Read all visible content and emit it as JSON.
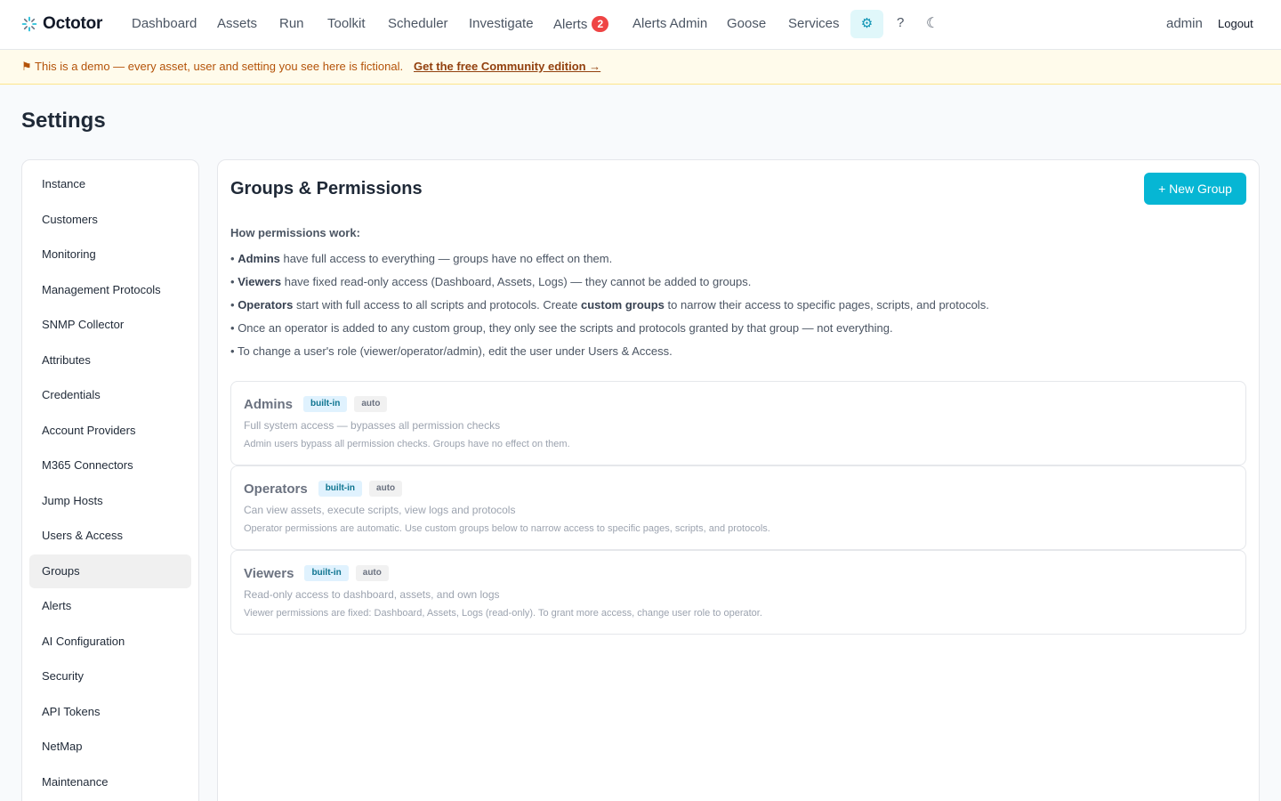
{
  "brand": {
    "name": "Octotor"
  },
  "nav": {
    "items": [
      "Dashboard",
      "Assets",
      "Run",
      "Toolkit",
      "Scheduler",
      "Investigate",
      "Alerts",
      "Alerts Admin",
      "Goose",
      "Services"
    ],
    "alerts_count": "2",
    "help": "?",
    "theme": "☾",
    "settings_icon": "⚙"
  },
  "user": {
    "name": "admin",
    "logout": "Logout"
  },
  "banner": {
    "text": "⚑ This is a demo — every asset, user and setting you see here is fictional.",
    "link": "Get the free Community edition →"
  },
  "page": {
    "title": "Settings"
  },
  "sidebar": {
    "items": [
      "Instance",
      "Customers",
      "Monitoring",
      "Management Protocols",
      "SNMP Collector",
      "Attributes",
      "Credentials",
      "Account Providers",
      "M365 Connectors",
      "Jump Hosts",
      "Users & Access",
      "Groups",
      "Alerts",
      "AI Configuration",
      "Security",
      "API Tokens",
      "NetMap",
      "Maintenance"
    ],
    "active": "Groups"
  },
  "panel": {
    "title": "Groups & Permissions",
    "new_group": "+ New Group",
    "howto_title": "How permissions work:",
    "howto": [
      {
        "bold": "Admins",
        "rest": " have full access to everything — groups have no effect on them."
      },
      {
        "bold": "Viewers",
        "rest": " have fixed read-only access (Dashboard, Assets, Logs) — they cannot be added to groups."
      },
      {
        "bold": "Operators",
        "rest": " start with full access to all scripts and protocols. Create ",
        "bold2": "custom groups",
        "rest2": " to narrow their access to specific pages, scripts, and protocols."
      },
      {
        "rest": "Once an operator is added to any custom group, they only see the scripts and protocols granted by that group — not everything."
      },
      {
        "rest": "To change a user's role (viewer/operator/admin), edit the user under Users & Access."
      }
    ],
    "bullet": "•",
    "groups": [
      {
        "name": "Admins",
        "tags": [
          "built-in",
          "auto"
        ],
        "desc": "Full system access — bypasses all permission checks",
        "note": "Admin users bypass all permission checks. Groups have no effect on them."
      },
      {
        "name": "Operators",
        "tags": [
          "built-in",
          "auto"
        ],
        "desc": "Can view assets, execute scripts, view logs and protocols",
        "note": "Operator permissions are automatic. Use custom groups below to narrow access to specific pages, scripts, and protocols."
      },
      {
        "name": "Viewers",
        "tags": [
          "built-in",
          "auto"
        ],
        "desc": "Read-only access to dashboard, assets, and own logs",
        "note": "Viewer permissions are fixed: Dashboard, Assets, Logs (read-only). To grant more access, change user role to operator."
      }
    ]
  },
  "colors": {
    "accent": "#06b6d4",
    "badge": "#ef4444",
    "banner_bg": "#fffbeb",
    "banner_text": "#b45309"
  }
}
